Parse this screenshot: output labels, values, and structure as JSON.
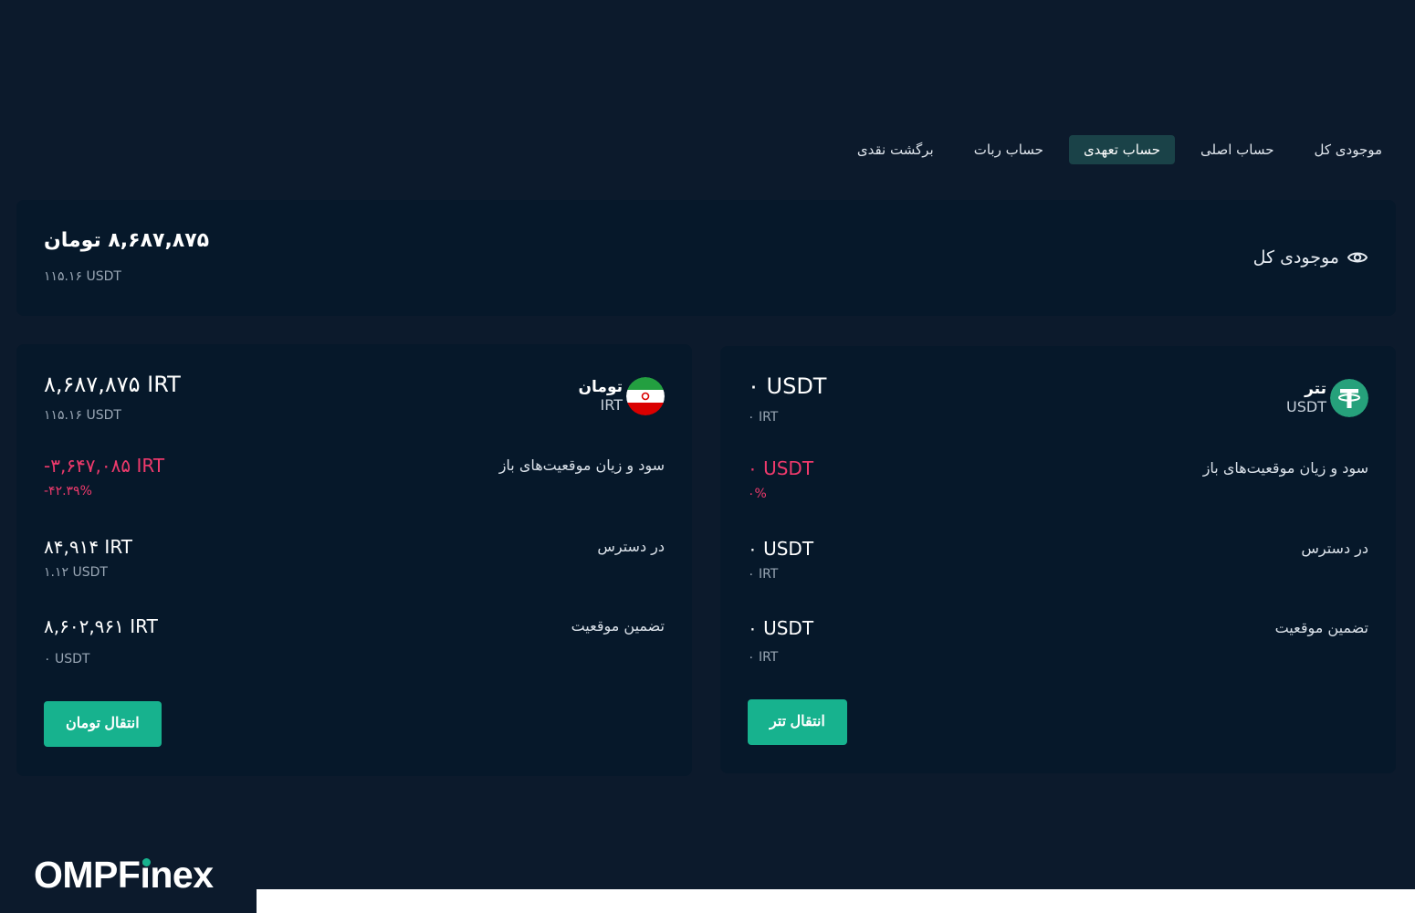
{
  "tabs": [
    {
      "label": "موجودی کل",
      "active": false
    },
    {
      "label": "حساب اصلی",
      "active": false
    },
    {
      "label": "حساب تعهدی",
      "active": true
    },
    {
      "label": "حساب ربات",
      "active": false
    },
    {
      "label": "برگشت نقدی",
      "active": false
    }
  ],
  "summary": {
    "label": "موجودی کل",
    "icon": "eye-icon",
    "amount": "۸,۶۸۷,۸۷۵ تومان",
    "amount_usdt": "۱۱۵.۱۶ USDT"
  },
  "wallets": {
    "irt": {
      "name": "تومان",
      "code": "IRT",
      "icon": "iran-flag-icon",
      "balance": "۸,۶۸۷,۸۷۵ IRT",
      "balance_sub": "۱۱۵.۱۶ USDT",
      "pnl_label": "سود و زیان موقعیت‌های باز",
      "pnl_value": "-۳,۶۴۷,۰۸۵ IRT",
      "pnl_sub": "-۴۲.۳۹%",
      "available_label": "در دسترس",
      "available_value": "۸۴,۹۱۴ IRT",
      "available_sub": "۱.۱۲ USDT",
      "margin_label": "تضمین موقعیت",
      "margin_value": "۸,۶۰۲,۹۶۱ IRT",
      "margin_sub": "۰ USDT",
      "button": "انتقال تومان"
    },
    "usdt": {
      "name": "تتر",
      "code": "USDT",
      "icon": "tether-icon",
      "balance": "۰ USDT",
      "balance_sub": "۰ IRT",
      "pnl_label": "سود و زیان موقعیت‌های باز",
      "pnl_value": "۰ USDT",
      "pnl_sub": "۰%",
      "available_label": "در دسترس",
      "available_value": "۰ USDT",
      "available_sub": "۰ IRT",
      "margin_label": "تضمین موقعیت",
      "margin_value": "۰ USDT",
      "margin_sub": "۰ IRT",
      "button": "انتقال تتر"
    }
  },
  "colors": {
    "background": "#0c1a2c",
    "card": "#06182a",
    "accent": "#17b28e",
    "negative": "#ee3a6c",
    "active_tab": "#1a4248"
  },
  "logo": {
    "part1": "OMPF",
    "part2": "i",
    "part3": "nex"
  }
}
